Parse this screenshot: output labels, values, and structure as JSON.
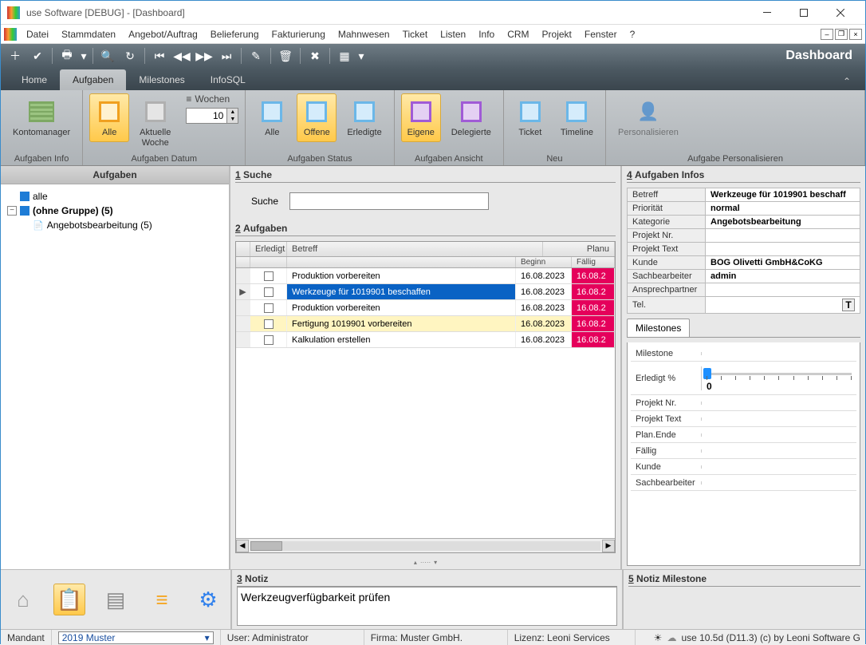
{
  "window": {
    "title": "use Software [DEBUG] - [Dashboard]"
  },
  "menu": [
    "Datei",
    "Stammdaten",
    "Angebot/Auftrag",
    "Belieferung",
    "Fakturierung",
    "Mahnwesen",
    "Ticket",
    "Listen",
    "Info",
    "CRM",
    "Projekt",
    "Fenster",
    "?"
  ],
  "toolbar_title": "Dashboard",
  "tabs": [
    "Home",
    "Aufgaben",
    "Milestones",
    "InfoSQL"
  ],
  "active_tab": "Aufgaben",
  "ribbon": {
    "group1_label": "Aufgaben Info",
    "kontomanager": "Kontomanager",
    "group2_label": "Aufgaben Datum",
    "alle": "Alle",
    "aktuelle_woche": "Aktuelle\nWoche",
    "wochen": "Wochen",
    "wochen_value": "10",
    "group3_label": "Aufgaben Status",
    "status_alle": "Alle",
    "offene": "Offene",
    "erledigte": "Erledigte",
    "group4_label": "Aufgaben Ansicht",
    "eigene": "Eigene",
    "delegierte": "Delegierte",
    "group5_label": "Neu",
    "ticket": "Ticket",
    "timeline": "Timeline",
    "group6_label": "Aufgabe Personalisieren",
    "personalisieren": "Personalisieren"
  },
  "left": {
    "header": "Aufgaben",
    "alle": "alle",
    "ohne_gruppe": "(ohne Gruppe) (5)",
    "angebot": "Angebotsbearbeitung (5)"
  },
  "center": {
    "sec1": "Suche",
    "sec1_num": "1",
    "suche_label": "Suche",
    "sec2": "Aufgaben",
    "sec2_num": "2",
    "col_erledigt": "Erledigt",
    "col_betreff": "Betreff",
    "col_planu": "Planu",
    "col_beginn": "Beginn",
    "col_faellig": "Fällig",
    "rows": [
      {
        "subj": "Produktion vorbereiten",
        "begin": "16.08.2023",
        "due": "16.08.2",
        "sel": false,
        "hl": false
      },
      {
        "subj": "Werkzeuge für 1019901 beschaffen",
        "begin": "16.08.2023",
        "due": "16.08.2",
        "sel": true,
        "hl": false
      },
      {
        "subj": "Produktion vorbereiten",
        "begin": "16.08.2023",
        "due": "16.08.2",
        "sel": false,
        "hl": false
      },
      {
        "subj": "Fertigung 1019901 vorbereiten",
        "begin": "16.08.2023",
        "due": "16.08.2",
        "sel": false,
        "hl": true
      },
      {
        "subj": "Kalkulation erstellen",
        "begin": "16.08.2023",
        "due": "16.08.2",
        "sel": false,
        "hl": false
      }
    ],
    "sec3": "Notiz",
    "sec3_num": "3",
    "notiz_text": "Werkzeugverfügbarkeit prüfen"
  },
  "right": {
    "header": "Aufgaben Infos",
    "header_num": "4",
    "rows": [
      {
        "lbl": "Betreff",
        "val": "Werkzeuge für 1019901 beschaff"
      },
      {
        "lbl": "Priorität",
        "val": "normal"
      },
      {
        "lbl": "Kategorie",
        "val": "Angebotsbearbeitung"
      },
      {
        "lbl": "Projekt Nr.",
        "val": ""
      },
      {
        "lbl": "Projekt Text",
        "val": ""
      },
      {
        "lbl": "Kunde",
        "val": "BOG Olivetti GmbH&CoKG"
      },
      {
        "lbl": "Sachbearbeiter",
        "val": "admin"
      },
      {
        "lbl": "Ansprechpartner",
        "val": ""
      },
      {
        "lbl": "Tel.",
        "val": ""
      }
    ],
    "ms_tab": "Milestones",
    "ms_rows": [
      "Milestone",
      "Erledigt %",
      "Projekt Nr.",
      "Projekt Text",
      "Plan.Ende",
      "Fällig",
      "Kunde",
      "Sachbearbeiter"
    ],
    "erledigt_val": "0",
    "sec5": "Notiz Milestone",
    "sec5_num": "5"
  },
  "status": {
    "mandant_lbl": "Mandant",
    "mandant_val": "2019 Muster",
    "user": "User: Administrator",
    "firma": "Firma: Muster GmbH.",
    "lizenz": "Lizenz: Leoni Services",
    "version": "use 10.5d (D11.3) (c) by Leoni Software G"
  }
}
